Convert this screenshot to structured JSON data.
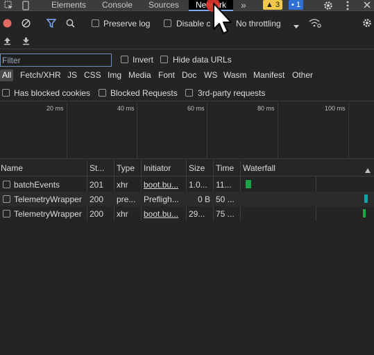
{
  "tabs": {
    "items": [
      {
        "label": "Elements"
      },
      {
        "label": "Console"
      },
      {
        "label": "Sources"
      },
      {
        "label": "Network",
        "active": true
      }
    ],
    "more_label": "»",
    "warnings_count": "3",
    "messages_count": "1"
  },
  "toolbar": {
    "preserve_log": "Preserve log",
    "disable_cache": "Disable c",
    "throttling": "No throttling"
  },
  "filter": {
    "placeholder": "Filter",
    "invert": "Invert",
    "hide_data_urls": "Hide data URLs",
    "types": [
      "All",
      "Fetch/XHR",
      "JS",
      "CSS",
      "Img",
      "Media",
      "Font",
      "Doc",
      "WS",
      "Wasm",
      "Manifest",
      "Other"
    ],
    "blocked_cookies": "Has blocked cookies",
    "blocked_requests": "Blocked Requests",
    "third_party": "3rd-party requests"
  },
  "overview": {
    "ticks": [
      "20 ms",
      "40 ms",
      "60 ms",
      "80 ms",
      "100 ms"
    ]
  },
  "table": {
    "columns": [
      "Name",
      "St...",
      "Type",
      "Initiator",
      "Size",
      "Time",
      "Waterfall"
    ],
    "rows": [
      {
        "name": "batchEvents",
        "status": "201",
        "type": "xhr",
        "initiator": "boot.bu...",
        "size": "1.0...",
        "time": "11...",
        "waterfall_start": 0.02,
        "waterfall_color": "#1ea446"
      },
      {
        "name": "TelemetryWrapper",
        "status": "200",
        "type": "pre...",
        "initiator": "Prefligh...",
        "size": "0 B",
        "time": "50 ...",
        "waterfall_start": 0.97,
        "waterfall_color": "#13a0a6"
      },
      {
        "name": "TelemetryWrapper",
        "status": "200",
        "type": "xhr",
        "initiator": "boot.bu...",
        "size": "29...",
        "time": "75 ...",
        "waterfall_start": 0.96,
        "waterfall_color": "#1ea446"
      }
    ]
  },
  "colors": {
    "accent": "#7cacf8",
    "background": "#242424",
    "record": "#e46962"
  }
}
